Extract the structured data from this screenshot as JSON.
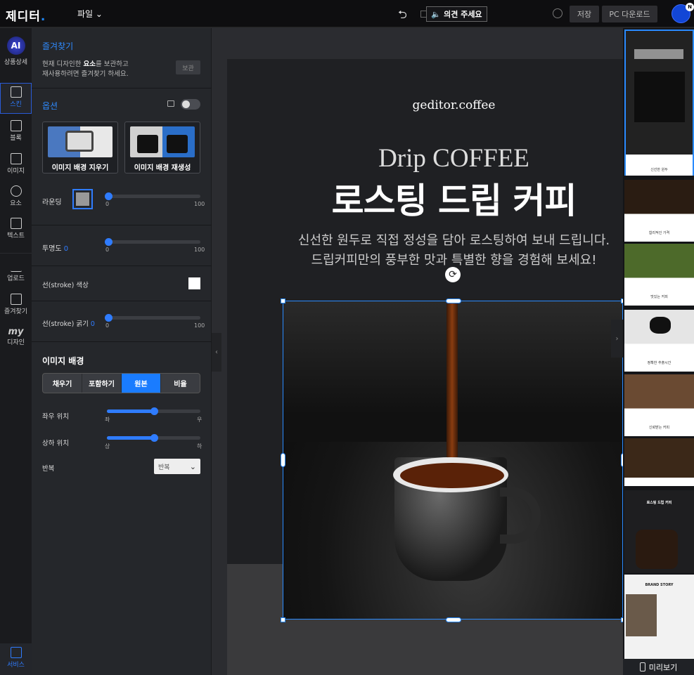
{
  "topbar": {
    "logo": "제디터",
    "file_menu": "파일",
    "feedback_button": "의견 주세요",
    "save_button": "저장",
    "pc_download_button": "PC 다운로드",
    "avatar_badge": "N"
  },
  "rail": {
    "items": [
      {
        "label": "상품상세",
        "icon": "ai-icon"
      },
      {
        "label": "스킨",
        "icon": "skin-icon"
      },
      {
        "label": "블록",
        "icon": "block-icon"
      },
      {
        "label": "이미지",
        "icon": "image-icon"
      },
      {
        "label": "요소",
        "icon": "shapes-icon"
      },
      {
        "label": "텍스트",
        "icon": "text-icon"
      },
      {
        "label": "업로드",
        "icon": "upload-icon"
      },
      {
        "label": "즐겨찾기",
        "icon": "bookmark-icon"
      },
      {
        "label": "디자인",
        "icon": "my-design-icon"
      },
      {
        "label": "서비스",
        "icon": "service-icon"
      }
    ],
    "ai_badge": "AI",
    "my_label": "my"
  },
  "panel": {
    "favorites_title": "즐겨찾기",
    "favorites_desc_1a": "현재 디자인한 ",
    "favorites_desc_1b": "요소",
    "favorites_desc_1c": "를 보관하고",
    "favorites_desc_2": "재사용하려면 즐겨찾기 하세요.",
    "keep_button": "보관",
    "options_title": "옵션",
    "remove_bg_button": "이미지 배경 지우기",
    "regen_bg_button": "이미지 배경 재생성",
    "rounding_label": "라운딩",
    "rounding_value": 0,
    "slider_min": "0",
    "slider_max": "100",
    "opacity_label": "투명도",
    "opacity_value": "0",
    "stroke_color_label": "선(stroke) 색상",
    "stroke_width_label": "선(stroke) 굵기",
    "stroke_width_value": "0",
    "image_bg_title": "이미지 배경",
    "fit_options": [
      "채우기",
      "포함하기",
      "원본",
      "비율"
    ],
    "fit_selected": "원본",
    "h_pos_label": "좌우 위치",
    "h_pos_min": "좌",
    "h_pos_max": "우",
    "h_pos_value": 0.5,
    "v_pos_label": "상하 위치",
    "v_pos_min": "상",
    "v_pos_max": "하",
    "v_pos_value": 0.5,
    "repeat_label": "반복",
    "repeat_value": "반복"
  },
  "canvas": {
    "brand": "geditor.coffee",
    "subtitle_en": "Drip COFFEE",
    "headline": "로스팅 드립 커피",
    "desc_line1": "신선한 원두로 직접 정성을 담아 로스팅하여 보내 드립니다.",
    "desc_line2": "드립커피만의 풍부한 맛과 특별한 향을 경험해 보세요!"
  },
  "thumbnails": {
    "items": [
      {
        "caption": "신선한 원두"
      },
      {
        "caption": "합리적인 가격"
      },
      {
        "caption": "맛있는 커피"
      },
      {
        "caption": "정확한 추출시간"
      },
      {
        "caption": "신뢰받는 커피"
      },
      {
        "caption": ""
      },
      {
        "caption": "로스팅 드립 커피"
      },
      {
        "caption": "BRAND STORY"
      }
    ],
    "preview_button": "미리보기"
  },
  "colors": {
    "accent": "#2f7cff",
    "panel_bg": "#25272b",
    "topbar_bg": "#0e0e10"
  }
}
